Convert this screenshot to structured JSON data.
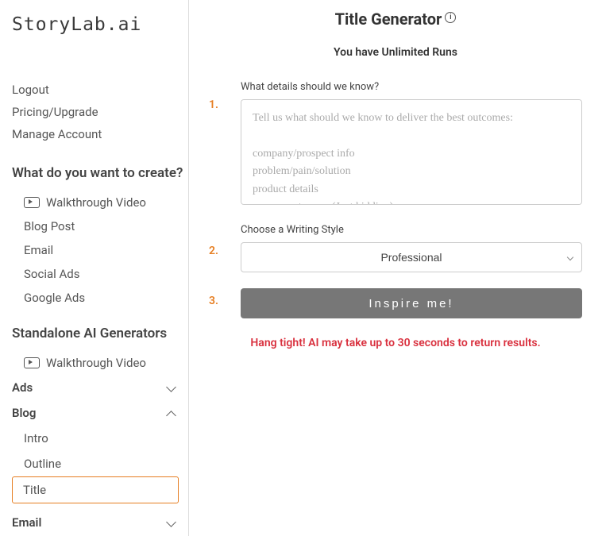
{
  "logo": "StoryLab.ai",
  "sidebar": {
    "top_links": [
      {
        "label": "Logout"
      },
      {
        "label": "Pricing/Upgrade"
      },
      {
        "label": "Manage Account"
      }
    ],
    "create_heading": "What do you want to create?",
    "walkthrough_label": "Walkthrough Video",
    "create_items": [
      {
        "label": "Blog Post"
      },
      {
        "label": "Email"
      },
      {
        "label": "Social Ads"
      },
      {
        "label": "Google Ads"
      }
    ],
    "generators_heading": "Standalone AI Generators",
    "accordions": {
      "ads": "Ads",
      "blog": "Blog",
      "email": "Email"
    },
    "blog_items": [
      {
        "label": "Intro"
      },
      {
        "label": "Outline"
      },
      {
        "label": "Title"
      }
    ]
  },
  "main": {
    "title": "Title Generator",
    "runs_text": "You have Unlimited Runs",
    "steps": {
      "s1": "1.",
      "s2": "2.",
      "s3": "3."
    },
    "details_label": "What details should we know?",
    "details_placeholder": "Tell us what should we know to deliver the best outcomes:\n\ncompany/prospect info\nproblem/pain/solution\nproduct details\nyour secret sauce (Just kidding)",
    "style_label": "Choose a Writing Style",
    "style_value": "Professional",
    "inspire_label": "Inspire me!",
    "loading_text": "Hang tight! AI may take up to 30 seconds to return results."
  }
}
